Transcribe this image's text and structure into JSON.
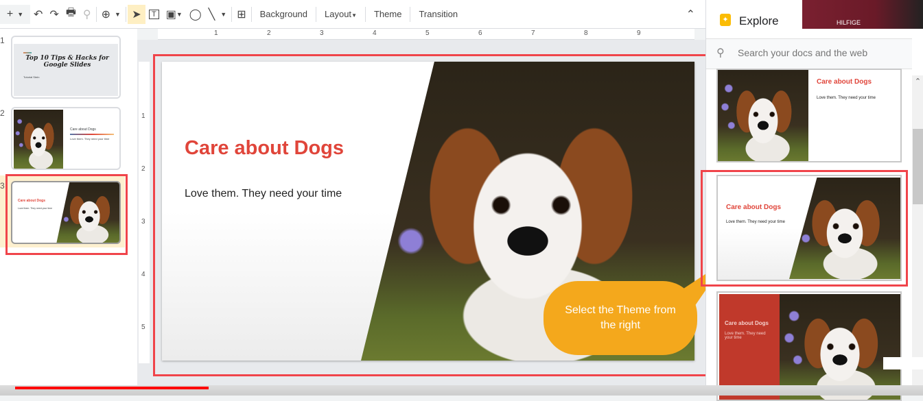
{
  "toolbar": {
    "new": "+",
    "undo": "↶",
    "redo": "↷",
    "print": "🖶",
    "paint": "⚲",
    "zoom": "⊕",
    "background": "Background",
    "layout": "Layout",
    "theme": "Theme",
    "transition": "Transition",
    "collapse": "⌃"
  },
  "ruler": {
    "h": [
      "1",
      "2",
      "3",
      "4",
      "5",
      "6",
      "7",
      "8",
      "9"
    ],
    "v": [
      "1",
      "2",
      "3",
      "4",
      "5"
    ]
  },
  "filmstrip": {
    "slides": [
      {
        "num": "1",
        "title": "Top 10 Tips & Hacks for Google Slides",
        "subtitle": "Tutorial Stein"
      },
      {
        "num": "2",
        "title": "Care about Dogs",
        "subtitle": "Love them. They need your time"
      },
      {
        "num": "3",
        "title": "Care about Dogs",
        "subtitle": "Love them. They need your time"
      }
    ]
  },
  "slide": {
    "title": "Care about Dogs",
    "subtitle": "Love them. They need your time"
  },
  "callout": {
    "text": "Select the Theme from the right"
  },
  "explore": {
    "title": "Explore",
    "search_placeholder": "Search your docs and the web",
    "webcam_text": "HILFIGE",
    "cards": [
      {
        "title": "Care about Dogs",
        "subtitle": "Love them. They need your time"
      },
      {
        "title": "Care about Dogs",
        "subtitle": "Love them. They need your time"
      },
      {
        "title": "Care about Dogs",
        "subtitle": "Love them. They need your time"
      }
    ]
  },
  "colors": {
    "accent": "#e0453a",
    "highlight": "#f0444a",
    "callout": "#f4a81c",
    "explore_icon": "#fbbc04"
  },
  "video": {
    "progress": 0.21
  }
}
